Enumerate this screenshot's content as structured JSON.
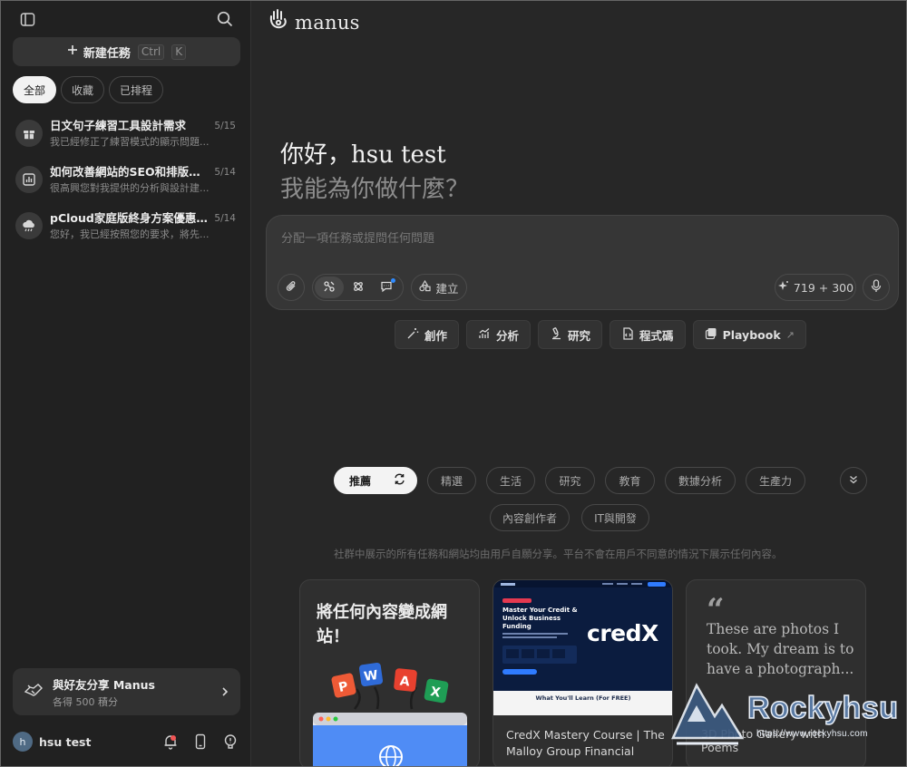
{
  "sidebar": {
    "new_task_label": "新建任務",
    "shortcut_ctrl": "Ctrl",
    "shortcut_key": "K",
    "filters": [
      "全部",
      "收藏",
      "已排程"
    ],
    "tasks": [
      {
        "title": "日文句子練習工具設計需求",
        "subtitle": "我已經修正了練習模式的顯示問題...",
        "date": "5/15",
        "icon": "gift-icon"
      },
      {
        "title": "如何改善網站的SEO和排版設...",
        "subtitle": "很高興您對我提供的分析與設計建...",
        "date": "5/14",
        "icon": "bar-chart-icon"
      },
      {
        "title": "pCloud家庭版終身方案優惠及...",
        "subtitle": "您好，我已經按照您的要求，將先...",
        "date": "5/14",
        "icon": "cloud-icon"
      }
    ],
    "share": {
      "title": "與好友分享 Manus",
      "subtitle": "各得 500 積分"
    },
    "user": {
      "initial": "h",
      "name": "hsu test"
    }
  },
  "main": {
    "logo_text": "manus",
    "greeting": "你好，hsu test",
    "question": "我能為你做什麼？",
    "composer": {
      "placeholder": "分配一項任務或提問任何問題",
      "build_label": "建立",
      "credits": "719 + 300"
    },
    "actions": [
      {
        "label": "創作",
        "icon": "magic-wand-icon"
      },
      {
        "label": "分析",
        "icon": "analytics-icon"
      },
      {
        "label": "研究",
        "icon": "microscope-icon"
      },
      {
        "label": "程式碼",
        "icon": "code-file-icon"
      },
      {
        "label": "Playbook",
        "icon": "playbook-icon"
      }
    ],
    "categories": [
      "推薦",
      "精選",
      "生活",
      "研究",
      "教育",
      "數據分析",
      "生產力",
      "內容創作者",
      "IT與開發"
    ],
    "notice": "社群中展示的所有任務和網站均由用戶自願分享。平台不會在用戶不同意的情況下展示任何內容。",
    "cards": {
      "card1_title": "將任何內容變成網站！",
      "card2_hero_title": "Master Your Credit & Unlock Business Funding",
      "card2_brand": "credX",
      "card2_section": "What You'll Learn (For FREE)",
      "card2_caption": "CredX Mastery Course | The Malloy Group Financial",
      "card3_quote": "These are photos I took. My dream is to have a photograph...",
      "card3_caption": "3D Photo Gallery with Poems"
    }
  },
  "watermark": {
    "brand": "Rockyhsu",
    "url": "https://www.rockyhsu.com"
  },
  "colors": {
    "background": "#272727",
    "sidebar": "#212121",
    "accent_blue": "#2f8bff",
    "credx_navy": "#0b1c3f",
    "notification_red": "#f15555"
  }
}
